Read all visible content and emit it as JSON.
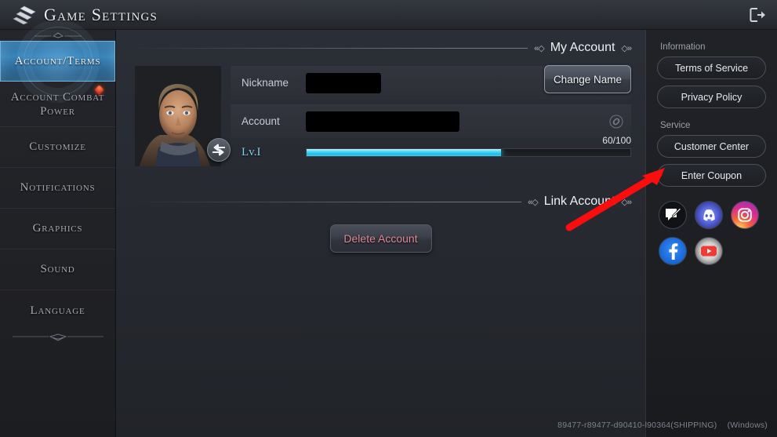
{
  "window": {
    "title": "Game Settings",
    "logo_icon": "game-logo-icon",
    "logout_icon": "logout-icon"
  },
  "sidebar": {
    "top_ornament": "ornament-divider",
    "bottom_ornament": "ornament-divider",
    "items": [
      {
        "label": "Account/Terms",
        "selected": true,
        "badge": false
      },
      {
        "label": "Account Combat Power",
        "selected": false,
        "badge": true
      },
      {
        "label": "Customize",
        "selected": false,
        "badge": false
      },
      {
        "label": "Notifications",
        "selected": false,
        "badge": false
      },
      {
        "label": "Graphics",
        "selected": false,
        "badge": false
      },
      {
        "label": "Sound",
        "selected": false,
        "badge": false
      },
      {
        "label": "Language",
        "selected": false,
        "badge": false
      }
    ]
  },
  "main": {
    "my_account": {
      "heading": "My Account",
      "ornament_left": "«◇",
      "ornament_right": "◇»",
      "avatar_icon": "character-portrait",
      "swap_icon": "swap-character-icon",
      "nickname": {
        "label": "Nickname",
        "value": "",
        "redacted": true,
        "button": "Change Name"
      },
      "account": {
        "label": "Account",
        "value": "",
        "redacted": true,
        "link_icon": "link-icon"
      },
      "level": {
        "label": "Lv.I",
        "progress_text": "60/100",
        "current": 60,
        "max": 100,
        "percent": 60,
        "bar_color": "#3fd2f2"
      }
    },
    "link_account": {
      "heading": "Link Account",
      "ornament_left": "«◇",
      "ornament_right": "◇»",
      "delete_button": "Delete Account",
      "delete_color": "#e08a92"
    }
  },
  "right_panel": {
    "information": {
      "title": "Information",
      "buttons": [
        "Terms of Service",
        "Privacy Policy"
      ]
    },
    "service": {
      "title": "Service",
      "buttons": [
        "Customer Center",
        "Enter Coupon"
      ]
    },
    "socials": [
      {
        "name": "forum-icon",
        "label": "Forum"
      },
      {
        "name": "discord-icon",
        "label": "Discord"
      },
      {
        "name": "instagram-icon",
        "label": "Instagram"
      },
      {
        "name": "facebook-icon",
        "label": "Facebook"
      },
      {
        "name": "youtube-icon",
        "label": "YouTube"
      }
    ]
  },
  "footer": {
    "build": "89477-r89477-d90410-l90364(SHIPPING)",
    "platform": "(Windows)"
  },
  "annotation": {
    "arrow_color": "#ff0000",
    "points_to": "Enter Coupon"
  }
}
